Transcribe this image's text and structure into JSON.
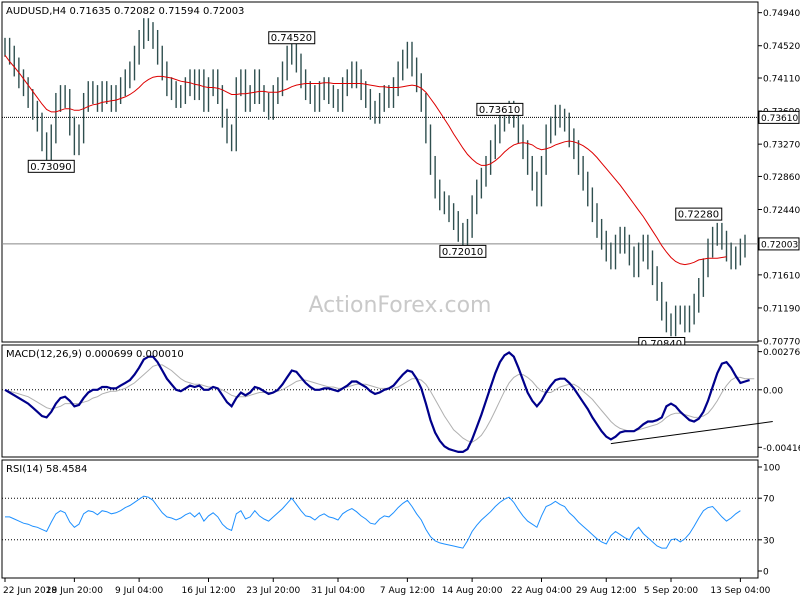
{
  "chart_data": {
    "type": "line",
    "watermark": "ActionForex.com",
    "price": {
      "title": "AUDUSD,H4  0.71635 0.72082 0.71594 0.72003",
      "ylim": [
        0.7077,
        0.7505
      ],
      "y_ticks": [
        "0.74940",
        "0.74520",
        "0.74110",
        "0.73690",
        "0.73270",
        "0.72860",
        "0.72440",
        "0.72030",
        "0.71610",
        "0.71190",
        "0.70770"
      ],
      "y_tick_values": [
        0.7494,
        0.7452,
        0.7411,
        0.7369,
        0.7327,
        0.7286,
        0.7244,
        0.7203,
        0.7161,
        0.7119,
        0.7077
      ],
      "current_price": 0.72003,
      "current_price_label": "0.72003",
      "resistance_level": 0.7361,
      "resistance_label": "0.73610",
      "close": [
        0.745,
        0.744,
        0.7425,
        0.741,
        0.74,
        0.7385,
        0.737,
        0.7355,
        0.733,
        0.7312,
        0.734,
        0.738,
        0.739,
        0.7385,
        0.735,
        0.7325,
        0.734,
        0.738,
        0.7395,
        0.739,
        0.738,
        0.7395,
        0.739,
        0.738,
        0.739,
        0.74,
        0.741,
        0.742,
        0.744,
        0.746,
        0.7475,
        0.747,
        0.746,
        0.744,
        0.742,
        0.74,
        0.7395,
        0.7385,
        0.739,
        0.74,
        0.741,
        0.7395,
        0.741,
        0.738,
        0.74,
        0.741,
        0.739,
        0.736,
        0.734,
        0.733,
        0.74,
        0.741,
        0.738,
        0.739,
        0.741,
        0.739,
        0.738,
        0.737,
        0.739,
        0.74,
        0.742,
        0.744,
        0.7455,
        0.743,
        0.741,
        0.7395,
        0.739,
        0.738,
        0.7395,
        0.74,
        0.739,
        0.7385,
        0.738,
        0.74,
        0.741,
        0.742,
        0.741,
        0.7395,
        0.7385,
        0.737,
        0.7365,
        0.738,
        0.739,
        0.7385,
        0.74,
        0.742,
        0.7435,
        0.7445,
        0.7425,
        0.7405,
        0.738,
        0.734,
        0.73,
        0.727,
        0.7255,
        0.725,
        0.724,
        0.723,
        0.7215,
        0.7205,
        0.722,
        0.725,
        0.727,
        0.7285,
        0.73,
        0.732,
        0.734,
        0.7355,
        0.7365,
        0.737,
        0.736,
        0.734,
        0.732,
        0.73,
        0.728,
        0.726,
        0.73,
        0.734,
        0.735,
        0.7365,
        0.736,
        0.7355,
        0.7335,
        0.732,
        0.73,
        0.728,
        0.726,
        0.724,
        0.722,
        0.7205,
        0.719,
        0.718,
        0.72,
        0.721,
        0.72,
        0.7185,
        0.717,
        0.719,
        0.72,
        0.718,
        0.716,
        0.714,
        0.7115,
        0.71,
        0.7095,
        0.711,
        0.711,
        0.71,
        0.711,
        0.7125,
        0.7145,
        0.717,
        0.7195,
        0.721,
        0.7215,
        0.7205,
        0.719,
        0.718,
        0.7185,
        0.7195,
        0.72
      ],
      "ma": [
        0.744,
        0.7432,
        0.7425,
        0.7418,
        0.741,
        0.7402,
        0.7394,
        0.7386,
        0.7378,
        0.7371,
        0.7368,
        0.7368,
        0.737,
        0.7372,
        0.7372,
        0.737,
        0.737,
        0.7372,
        0.7375,
        0.7377,
        0.7378,
        0.738,
        0.7381,
        0.7382,
        0.7383,
        0.7385,
        0.7387,
        0.739,
        0.7394,
        0.7399,
        0.7405,
        0.7409,
        0.7412,
        0.7413,
        0.7413,
        0.7412,
        0.7411,
        0.7409,
        0.7407,
        0.7406,
        0.7405,
        0.7403,
        0.7402,
        0.74,
        0.7399,
        0.7399,
        0.7398,
        0.7396,
        0.7393,
        0.739,
        0.739,
        0.7391,
        0.7391,
        0.7392,
        0.7393,
        0.7394,
        0.7394,
        0.7393,
        0.7393,
        0.7393,
        0.7395,
        0.7397,
        0.74,
        0.7402,
        0.7403,
        0.7404,
        0.7404,
        0.7404,
        0.7404,
        0.7405,
        0.7405,
        0.7404,
        0.7404,
        0.7404,
        0.7404,
        0.7404,
        0.7404,
        0.7404,
        0.7403,
        0.7402,
        0.7401,
        0.74,
        0.74,
        0.7399,
        0.7399,
        0.7399,
        0.74,
        0.7401,
        0.7402,
        0.7401,
        0.7398,
        0.7393,
        0.7385,
        0.7377,
        0.7368,
        0.7359,
        0.735,
        0.734,
        0.7331,
        0.7322,
        0.7314,
        0.7308,
        0.7303,
        0.73,
        0.73,
        0.7302,
        0.7306,
        0.7311,
        0.7317,
        0.7322,
        0.7326,
        0.7328,
        0.7329,
        0.7328,
        0.7326,
        0.7322,
        0.732,
        0.7321,
        0.7323,
        0.7326,
        0.7328,
        0.733,
        0.7331,
        0.733,
        0.7328,
        0.7325,
        0.7321,
        0.7316,
        0.731,
        0.7303,
        0.7296,
        0.7289,
        0.7282,
        0.7275,
        0.7267,
        0.7259,
        0.7251,
        0.7243,
        0.7235,
        0.7226,
        0.7217,
        0.7208,
        0.7198,
        0.719,
        0.7183,
        0.7178,
        0.7175,
        0.7174,
        0.7175,
        0.7177,
        0.718,
        0.7181,
        0.7182,
        0.7182,
        0.7182,
        0.7183,
        0.7184
      ],
      "labels": [
        {
          "text": "0.73090",
          "index": 10,
          "value": 0.7309,
          "pos": "below"
        },
        {
          "text": "0.74520",
          "index": 62,
          "value": 0.7452,
          "pos": "above"
        },
        {
          "text": "0.73610",
          "index": 107,
          "value": 0.7361,
          "pos": "above"
        },
        {
          "text": "0.72010",
          "index": 99,
          "value": 0.7201,
          "pos": "below"
        },
        {
          "text": "0.72280",
          "index": 150,
          "value": 0.7228,
          "pos": "above"
        },
        {
          "text": "0.70840",
          "index": 142,
          "value": 0.7084,
          "pos": "below"
        }
      ]
    },
    "macd": {
      "title": "MACD(12,26,9) 0.000699 0.000010",
      "ylim": [
        -0.0048,
        0.0031
      ],
      "y_ticks": [
        "0.002764",
        "0.00",
        "-0.004169"
      ],
      "y_tick_values": [
        0.002764,
        0.0,
        -0.004169
      ],
      "macd": [
        0.0,
        -0.0002,
        -0.0004,
        -0.0006,
        -0.0008,
        -0.001,
        -0.0013,
        -0.0016,
        -0.0019,
        -0.002,
        -0.0016,
        -0.001,
        -0.0006,
        -0.0005,
        -0.0008,
        -0.0012,
        -0.0011,
        -0.0006,
        -0.0002,
        0.0,
        0.0,
        0.0002,
        0.0002,
        0.0001,
        0.0001,
        0.0003,
        0.0005,
        0.0007,
        0.0011,
        0.0016,
        0.0022,
        0.0024,
        0.0024,
        0.002,
        0.0014,
        0.0008,
        0.0004,
        0.0,
        -0.0001,
        0.0001,
        0.0003,
        0.0002,
        0.0003,
        0.0,
        0.0,
        0.0002,
        0.0001,
        -0.0004,
        -0.0009,
        -0.0012,
        -0.0006,
        -0.0002,
        -0.0004,
        -0.0002,
        0.0002,
        0.0001,
        -0.0001,
        -0.0003,
        -0.0002,
        0.0,
        0.0004,
        0.0009,
        0.0014,
        0.0013,
        0.0009,
        0.0005,
        0.0002,
        0.0,
        0.0,
        0.0001,
        0.0001,
        0.0,
        -0.0001,
        0.0001,
        0.0003,
        0.0006,
        0.0006,
        0.0004,
        0.0002,
        -0.0001,
        -0.0003,
        -0.0002,
        0.0,
        0.0001,
        0.0003,
        0.0007,
        0.0011,
        0.0014,
        0.0013,
        0.0008,
        0.0001,
        -0.001,
        -0.0022,
        -0.0031,
        -0.0037,
        -0.0041,
        -0.0043,
        -0.0044,
        -0.0045,
        -0.0045,
        -0.0043,
        -0.0036,
        -0.0027,
        -0.0018,
        -0.0008,
        0.0002,
        0.0012,
        0.002,
        0.0025,
        0.0027,
        0.0024,
        0.0016,
        0.0007,
        -0.0002,
        -0.0008,
        -0.0012,
        -0.0008,
        -0.0002,
        0.0003,
        0.0007,
        0.0008,
        0.0008,
        0.0005,
        0.0001,
        -0.0004,
        -0.0009,
        -0.0014,
        -0.002,
        -0.0025,
        -0.003,
        -0.0034,
        -0.0036,
        -0.0034,
        -0.0031,
        -0.003,
        -0.003,
        -0.003,
        -0.0028,
        -0.0025,
        -0.0023,
        -0.0023,
        -0.0022,
        -0.002,
        -0.0012,
        -0.001,
        -0.0012,
        -0.0016,
        -0.0019,
        -0.0022,
        -0.0023,
        -0.0021,
        -0.0016,
        -0.0008,
        0.0002,
        0.0012,
        0.0019,
        0.002,
        0.0016,
        0.001,
        0.0005,
        0.0006,
        0.0007
      ],
      "signal": [
        0.0,
        -0.0001,
        -0.0002,
        -0.0003,
        -0.0004,
        -0.0005,
        -0.0007,
        -0.0009,
        -0.0011,
        -0.0013,
        -0.0014,
        -0.0013,
        -0.0012,
        -0.001,
        -0.001,
        -0.001,
        -0.001,
        -0.0009,
        -0.0008,
        -0.0006,
        -0.0005,
        -0.0003,
        -0.0002,
        -0.0001,
        -0.0001,
        0.0,
        0.0001,
        0.0003,
        0.0005,
        0.0008,
        0.0011,
        0.0014,
        0.0017,
        0.0018,
        0.0018,
        0.0016,
        0.0014,
        0.0011,
        0.0008,
        0.0006,
        0.0005,
        0.0004,
        0.0004,
        0.0003,
        0.0002,
        0.0002,
        0.0001,
        0.0,
        -0.0002,
        -0.0004,
        -0.0005,
        -0.0005,
        -0.0005,
        -0.0004,
        -0.0003,
        -0.0002,
        -0.0002,
        -0.0002,
        -0.0002,
        -0.0001,
        0.0,
        0.0002,
        0.0004,
        0.0006,
        0.0007,
        0.0007,
        0.0006,
        0.0005,
        0.0004,
        0.0003,
        0.0002,
        0.0002,
        0.0001,
        0.0001,
        0.0002,
        0.0003,
        0.0004,
        0.0004,
        0.0004,
        0.0003,
        0.0002,
        0.0001,
        0.0001,
        0.0001,
        0.0001,
        0.0002,
        0.0004,
        0.0006,
        0.0008,
        0.0008,
        0.0007,
        0.0004,
        -0.0001,
        -0.0007,
        -0.0013,
        -0.0019,
        -0.0024,
        -0.0029,
        -0.0032,
        -0.0035,
        -0.0037,
        -0.0038,
        -0.0036,
        -0.0033,
        -0.0028,
        -0.0022,
        -0.0015,
        -0.0008,
        -0.0001,
        0.0005,
        0.0009,
        0.0011,
        0.0011,
        0.0009,
        0.0006,
        0.0002,
        -0.0001,
        -0.0002,
        -0.0002,
        0.0,
        0.0002,
        0.0003,
        0.0004,
        0.0004,
        0.0002,
        -0.0001,
        -0.0004,
        -0.0007,
        -0.0011,
        -0.0015,
        -0.0019,
        -0.0023,
        -0.0026,
        -0.0028,
        -0.0029,
        -0.003,
        -0.003,
        -0.0029,
        -0.0028,
        -0.0027,
        -0.0026,
        -0.0025,
        -0.0023,
        -0.002,
        -0.0018,
        -0.0017,
        -0.0017,
        -0.0018,
        -0.0019,
        -0.002,
        -0.002,
        -0.0019,
        -0.0017,
        -0.0013,
        -0.0008,
        -0.0002,
        0.0003,
        0.0007,
        0.0009,
        0.0009,
        0.0008,
        0.0008,
        0.0008
      ],
      "trendline": [
        {
          "index": 131,
          "value": -0.0039
        },
        {
          "index": 166,
          "value": -0.0023
        }
      ]
    },
    "rsi": {
      "title": "RSI(14) 58.4584",
      "ylim": [
        0,
        100
      ],
      "y_ticks": [
        "100",
        "70",
        "30",
        "0"
      ],
      "y_tick_values": [
        100,
        70,
        30,
        0
      ],
      "levels": [
        70,
        30
      ],
      "values": [
        52,
        52,
        50,
        48,
        46,
        45,
        43,
        42,
        40,
        38,
        47,
        55,
        58,
        56,
        47,
        42,
        45,
        55,
        58,
        57,
        54,
        58,
        57,
        55,
        56,
        58,
        61,
        63,
        66,
        69,
        72,
        71,
        68,
        62,
        56,
        52,
        51,
        49,
        51,
        54,
        56,
        52,
        56,
        48,
        53,
        56,
        52,
        45,
        41,
        39,
        55,
        58,
        50,
        52,
        58,
        53,
        50,
        48,
        52,
        56,
        60,
        65,
        70,
        64,
        58,
        53,
        52,
        49,
        53,
        55,
        52,
        51,
        49,
        55,
        58,
        60,
        57,
        53,
        50,
        46,
        45,
        50,
        53,
        52,
        56,
        61,
        65,
        68,
        62,
        55,
        49,
        40,
        33,
        29,
        27,
        26,
        25,
        24,
        23,
        22,
        29,
        38,
        44,
        49,
        53,
        57,
        62,
        66,
        69,
        71,
        66,
        59,
        53,
        48,
        45,
        42,
        53,
        62,
        64,
        67,
        64,
        62,
        56,
        52,
        47,
        43,
        39,
        35,
        31,
        28,
        26,
        34,
        38,
        35,
        32,
        30,
        38,
        42,
        36,
        32,
        28,
        24,
        22,
        22,
        30,
        31,
        28,
        31,
        36,
        43,
        51,
        58,
        61,
        62,
        57,
        52,
        48,
        51,
        55,
        58
      ],
      "x_ticks": [
        "22 Jun 2018",
        "29 Jun 20:00",
        "9 Jul 04:00",
        "16 Jul 12:00",
        "23 Jul 20:00",
        "31 Jul 04:00",
        "7 Aug 12:00",
        "14 Aug 20:00",
        "22 Aug 04:00",
        "29 Aug 12:00",
        "5 Sep 20:00",
        "13 Sep 04:00"
      ],
      "x_tick_index": [
        0,
        15,
        29,
        44,
        58,
        72,
        87,
        101,
        116,
        130,
        144,
        159
      ]
    }
  }
}
